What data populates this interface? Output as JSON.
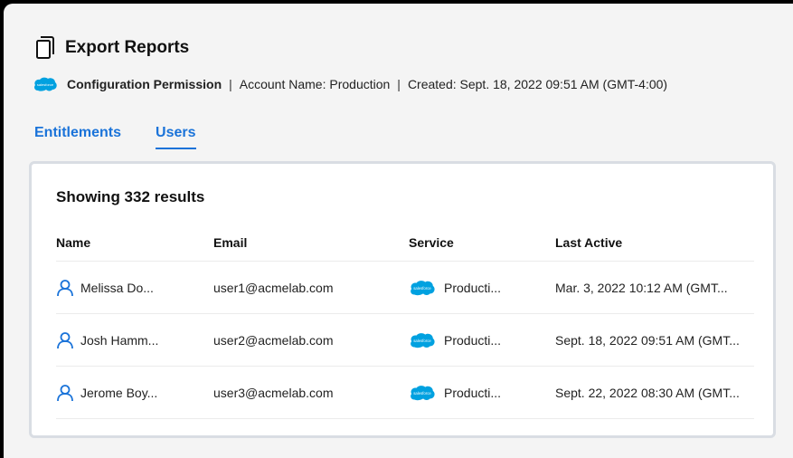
{
  "header": {
    "title": "Export Reports",
    "icon": "documents-icon"
  },
  "meta": {
    "brand_logo": "salesforce",
    "permission": "Configuration Permission",
    "separator": "|",
    "account": "Account Name: Production",
    "created": "Created: Sept. 18, 2022 09:51 AM (GMT-4:00)"
  },
  "tabs": [
    {
      "label": "Entitlements",
      "active": false
    },
    {
      "label": "Users",
      "active": true
    }
  ],
  "results": {
    "heading": "Showing 332 results",
    "columns": [
      "Name",
      "Email",
      "Service",
      "Last Active"
    ],
    "rows": [
      {
        "name": "Melissa Do...",
        "email": "user1@acmelab.com",
        "service": "Producti...",
        "last_active": "Mar. 3, 2022 10:12 AM (GMT..."
      },
      {
        "name": "Josh Hamm...",
        "email": "user2@acmelab.com",
        "service": "Producti...",
        "last_active": "Sept. 18, 2022 09:51 AM (GMT..."
      },
      {
        "name": "Jerome Boy...",
        "email": "user3@acmelab.com",
        "service": "Producti...",
        "last_active": "Sept. 22, 2022 08:30 AM (GMT..."
      }
    ]
  },
  "colors": {
    "accent": "#1a73d9",
    "salesforce": "#00a1e0"
  }
}
